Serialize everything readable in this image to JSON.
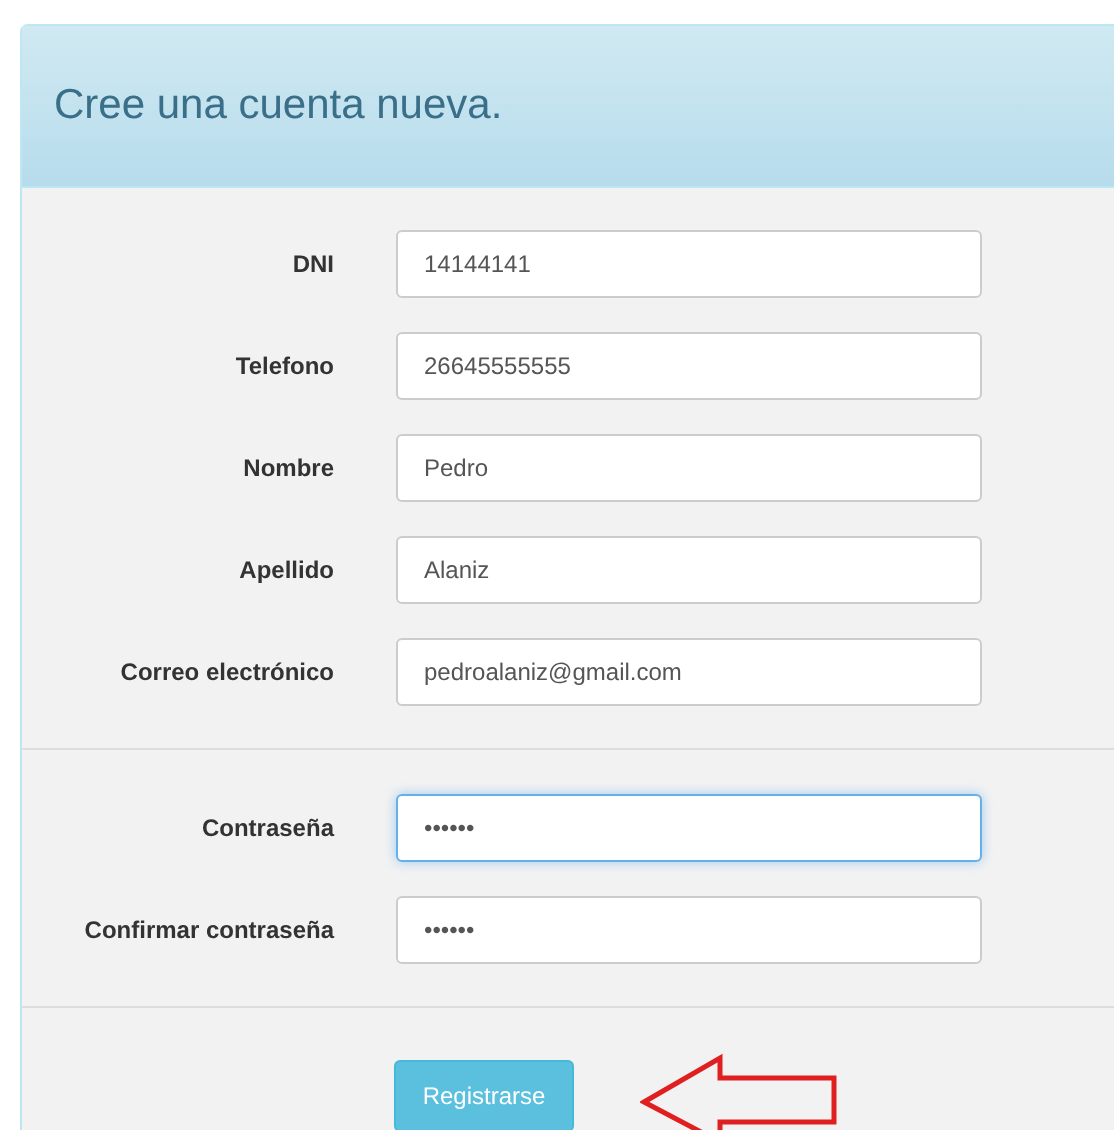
{
  "panel": {
    "title": "Cree una cuenta nueva."
  },
  "field_groups": [
    {
      "fields": [
        {
          "label": "DNI",
          "value": "14144141",
          "focused": false
        },
        {
          "label": "Telefono",
          "value": "26645555555",
          "focused": false
        },
        {
          "label": "Nombre",
          "value": "Pedro",
          "focused": false
        },
        {
          "label": "Apellido",
          "value": "Alaniz",
          "focused": false
        },
        {
          "label": "Correo electrónico",
          "value": "pedroalaniz@gmail.com",
          "focused": false
        }
      ]
    },
    {
      "fields": [
        {
          "label": "Contraseña",
          "value": "••••••",
          "focused": true
        },
        {
          "label": "Confirmar contraseña",
          "value": "••••••",
          "focused": false
        }
      ]
    }
  ],
  "submit_button": {
    "label": "Registrarse"
  }
}
